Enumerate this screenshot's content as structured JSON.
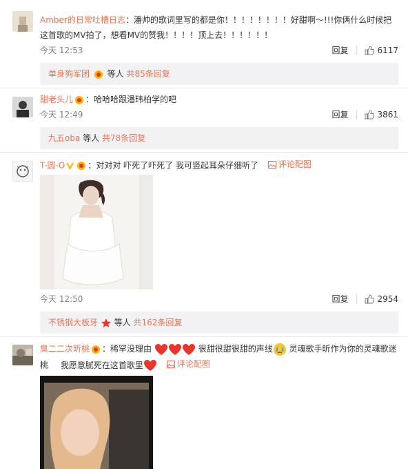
{
  "comments": [
    {
      "username": "Amber的日常吐槽日志",
      "text": "：潘帅的歌词里写的都是你！！！！！！！！好甜啊～!!!你俩什么时候把这首歌的MV拍了，想看MV的赞我！！！！顶上去！！！！！！",
      "time": "今天 12:53",
      "reply_label": "回复",
      "likes": "6117",
      "sub": {
        "name": "单身狗军团",
        "text": "等人",
        "count": "共85条回复"
      }
    },
    {
      "username": "甜老头儿",
      "text": "：哈哈哈跟潘玮柏学的吧",
      "time": "今天 12:49",
      "reply_label": "回复",
      "likes": "3861",
      "sub": {
        "name": "九五oba",
        "text": "等人",
        "count": "共78条回复"
      }
    },
    {
      "username": "T-圆-O",
      "text": "：对对对 吓死了吓死了 我可竖起耳朵仔细听了",
      "report": "评论配图",
      "time": "今天 12:50",
      "reply_label": "回复",
      "likes": "2954",
      "sub": {
        "name": "不锈钢大板牙",
        "text": "等人",
        "count": "共162条回复"
      }
    },
    {
      "username": "臭二二次昕桃",
      "text_a": "：稀罕没理由",
      "text_b": "很甜很甜很甜的声线",
      "text_c": "灵魂歌手昕作为你的灵魂歌迷桃",
      "text_d": "我愿意腻死在这首歌里",
      "report": "评论配图"
    }
  ],
  "colors": {
    "accent": "#eb7350",
    "subbox_bg": "#f2f2f5",
    "heart": "#e8362c"
  }
}
